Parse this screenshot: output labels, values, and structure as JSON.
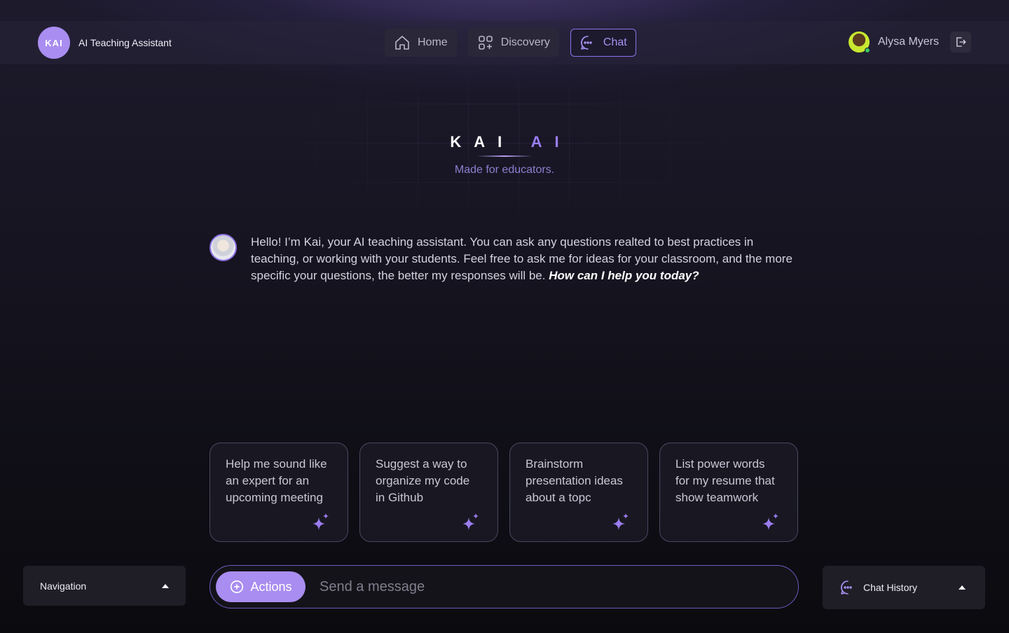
{
  "brand": {
    "logo_text": "KAI",
    "title": "AI Teaching Assistant"
  },
  "nav": {
    "items": [
      {
        "label": "Home",
        "icon": "home-icon",
        "active": false
      },
      {
        "label": "Discovery",
        "icon": "grid-plus-icon",
        "active": false
      },
      {
        "label": "Chat",
        "icon": "chat-bubble-icon",
        "active": true
      }
    ]
  },
  "user": {
    "name": "Alysa Myers",
    "status": "online"
  },
  "hero": {
    "logo_main": "KAI",
    "logo_accent": "AI",
    "tagline": "Made for educators."
  },
  "assistant_message": {
    "text": "Hello! I’m Kai, your AI teaching assistant. You can ask any questions realted to best practices in teaching, or working with your students. Feel free to ask me for ideas for your classroom, and the more specific your questions, the better my responses will be.",
    "emphasis": "How can I help you today?"
  },
  "prompts": [
    {
      "text": "Help me sound like an expert for an upcoming meeting"
    },
    {
      "text": "Suggest a way to organize my code in Github"
    },
    {
      "text": "Brainstorm presentation ideas about a topc"
    },
    {
      "text": "List power words for my resume that show teamwork"
    }
  ],
  "navigation_panel": {
    "label": "Navigation"
  },
  "composer": {
    "actions_label": "Actions",
    "placeholder": "Send a message",
    "value": ""
  },
  "chat_history": {
    "label": "Chat History"
  },
  "colors": {
    "accent": "#a98df0",
    "accent_border": "#8f73e8",
    "background": "#100f17"
  }
}
